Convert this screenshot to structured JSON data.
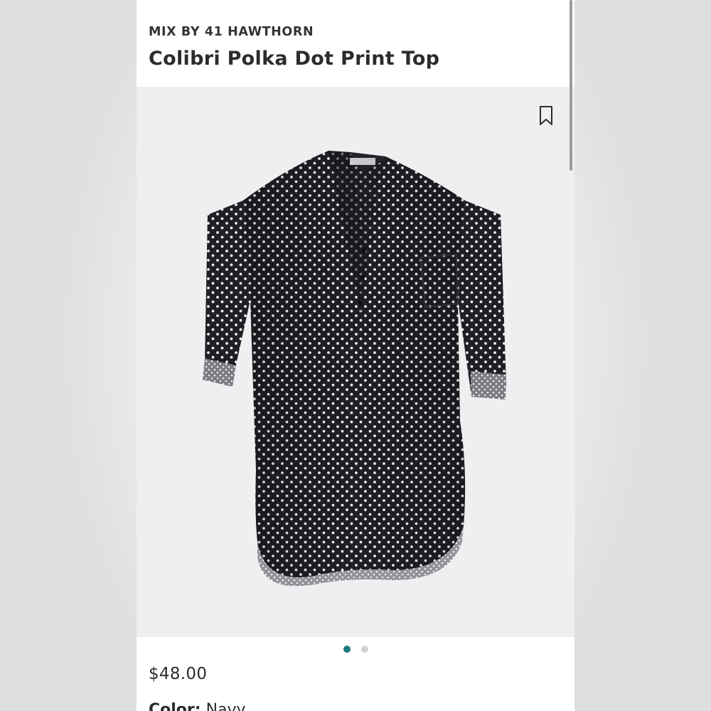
{
  "product": {
    "brand": "MIX BY 41 HAWTHORN",
    "title": "Colibri Polka Dot Print Top",
    "price": "$48.00",
    "color_label": "Color:",
    "color_value": "Navy"
  },
  "gallery": {
    "image_name": "polka-dot-top-image",
    "bookmark_icon": "bookmark-icon",
    "dots": [
      {
        "active": true,
        "color": "#1b7a7c"
      },
      {
        "active": false,
        "color": "#d3d3d5"
      }
    ],
    "background_color": "#efeff1"
  },
  "colors": {
    "text": "#2b2c2e",
    "shirt": "#1f1f24",
    "dot_active": "#1b7a7c"
  }
}
